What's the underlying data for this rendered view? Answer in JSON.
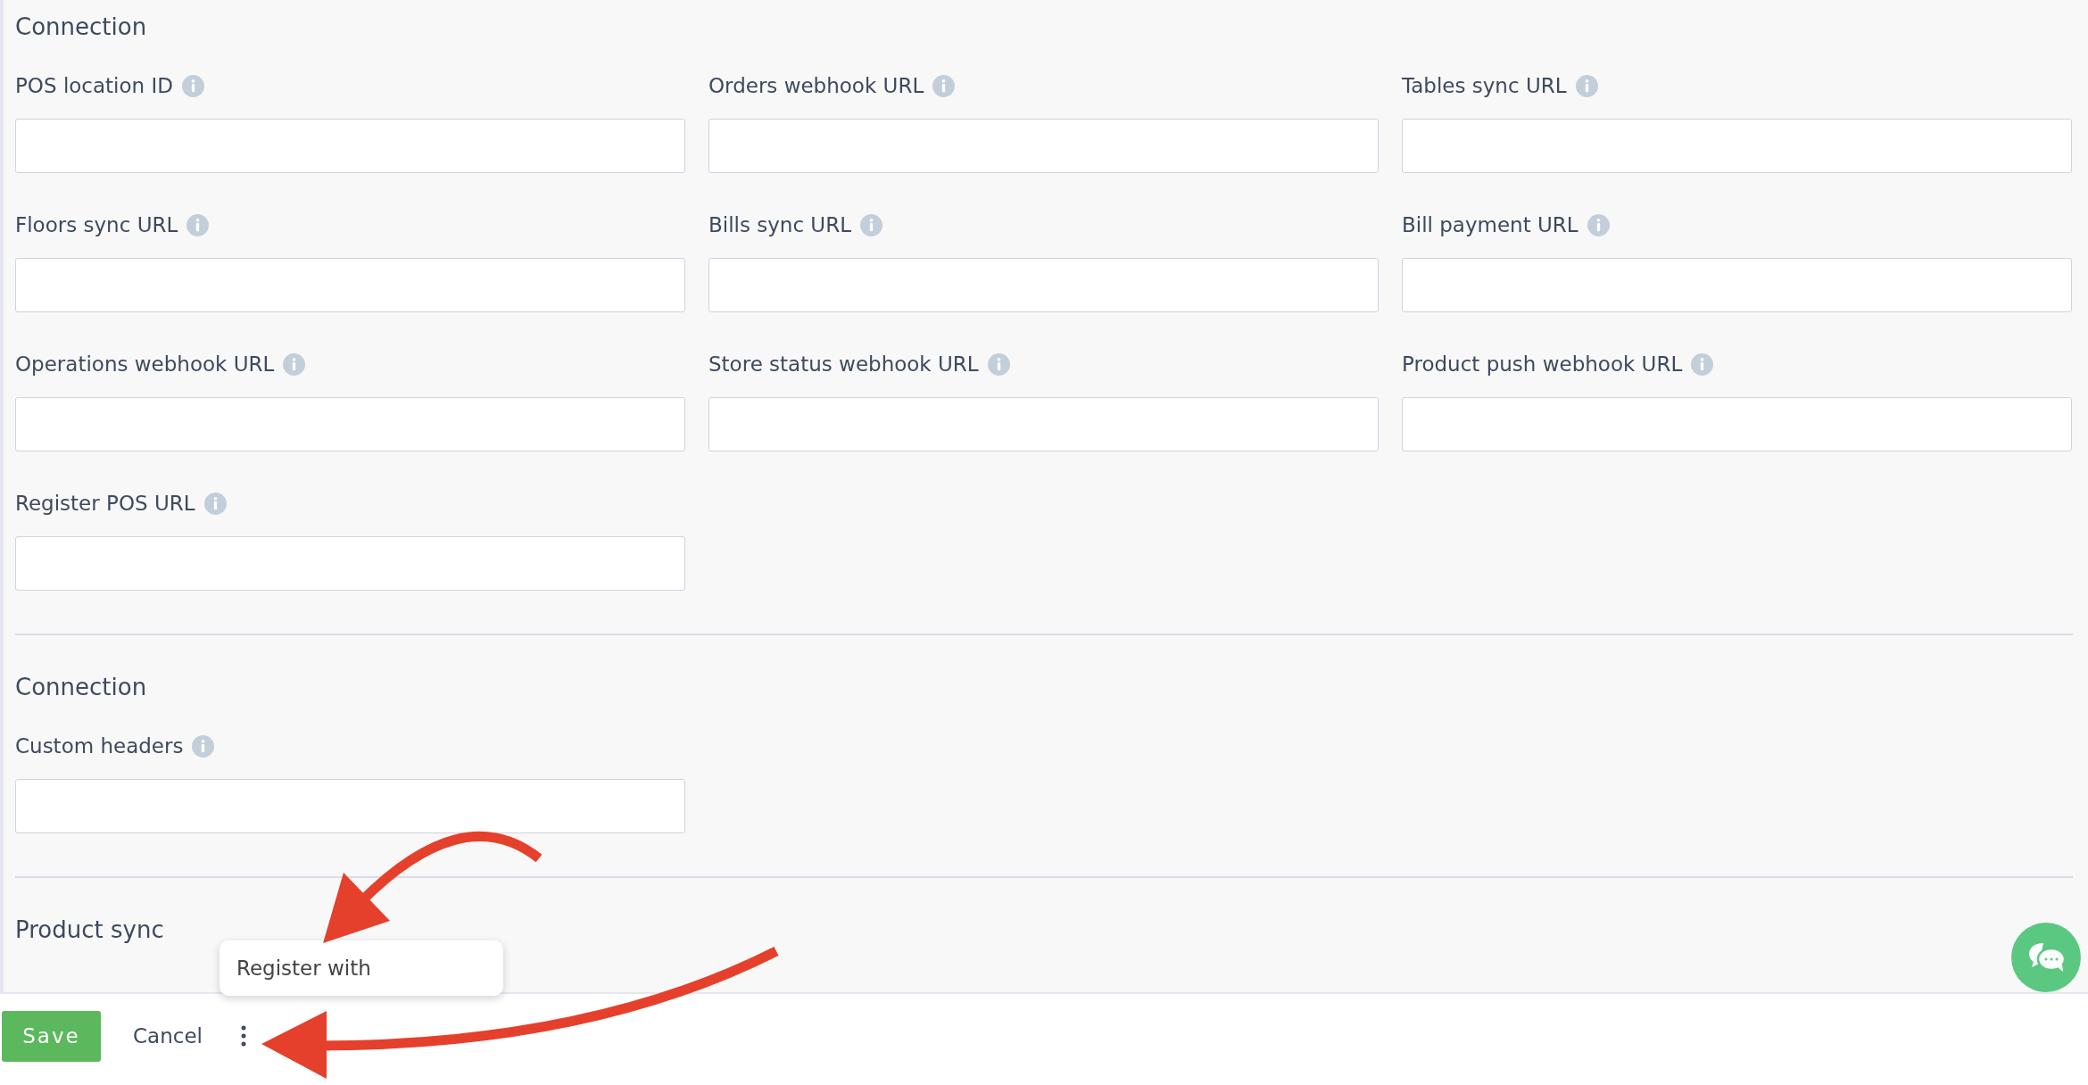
{
  "sections": [
    {
      "title": "Connection",
      "fields": [
        {
          "label": "POS location ID",
          "info": true
        },
        {
          "label": "Orders webhook URL",
          "info": true
        },
        {
          "label": "Tables sync URL",
          "info": true
        },
        {
          "label": "Floors sync URL",
          "info": true
        },
        {
          "label": "Bills sync URL",
          "info": true
        },
        {
          "label": "Bill payment URL",
          "info": true
        },
        {
          "label": "Operations webhook URL",
          "info": true
        },
        {
          "label": "Store status webhook URL",
          "info": true
        },
        {
          "label": "Product push webhook URL",
          "info": true
        },
        {
          "label": "Register POS URL",
          "info": true
        }
      ]
    },
    {
      "title": "Connection",
      "fields": [
        {
          "label": "Custom headers",
          "info": true
        }
      ]
    },
    {
      "title": "Product sync"
    }
  ],
  "footer": {
    "buttons": [
      {
        "label": "Save",
        "kind": "primary"
      },
      {
        "label": "Cancel",
        "kind": "text"
      }
    ],
    "more_menu": true
  },
  "popup_menu": {
    "items": [
      "Register with"
    ]
  },
  "chat_button": true
}
